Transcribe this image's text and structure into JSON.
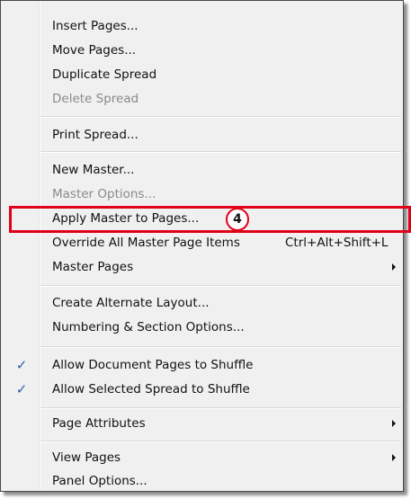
{
  "menu": {
    "items": [
      {
        "label": "Insert Pages...",
        "shortcut": "",
        "submenu": false,
        "disabled": false,
        "checked": false
      },
      {
        "label": "Move Pages...",
        "shortcut": "",
        "submenu": false,
        "disabled": false,
        "checked": false
      },
      {
        "label": "Duplicate Spread",
        "shortcut": "",
        "submenu": false,
        "disabled": false,
        "checked": false
      },
      {
        "label": "Delete Spread",
        "shortcut": "",
        "submenu": false,
        "disabled": true,
        "checked": false
      },
      {
        "label": "Print Spread...",
        "shortcut": "",
        "submenu": false,
        "disabled": false,
        "checked": false
      },
      {
        "label": "New Master...",
        "shortcut": "",
        "submenu": false,
        "disabled": false,
        "checked": false
      },
      {
        "label": "Master Options...",
        "shortcut": "",
        "submenu": false,
        "disabled": true,
        "checked": false
      },
      {
        "label": "Apply Master to Pages...",
        "shortcut": "",
        "submenu": false,
        "disabled": false,
        "checked": false
      },
      {
        "label": "Override All Master Page Items",
        "shortcut": "Ctrl+Alt+Shift+L",
        "submenu": false,
        "disabled": false,
        "checked": false
      },
      {
        "label": "Master Pages",
        "shortcut": "",
        "submenu": true,
        "disabled": false,
        "checked": false
      },
      {
        "label": "Create Alternate Layout...",
        "shortcut": "",
        "submenu": false,
        "disabled": false,
        "checked": false
      },
      {
        "label": "Numbering & Section Options...",
        "shortcut": "",
        "submenu": false,
        "disabled": false,
        "checked": false
      },
      {
        "label": "Allow Document Pages to Shuffle",
        "shortcut": "",
        "submenu": false,
        "disabled": false,
        "checked": true
      },
      {
        "label": "Allow Selected Spread to Shuffle",
        "shortcut": "",
        "submenu": false,
        "disabled": false,
        "checked": true
      },
      {
        "label": "Page Attributes",
        "shortcut": "",
        "submenu": true,
        "disabled": false,
        "checked": false
      },
      {
        "label": "View Pages",
        "shortcut": "",
        "submenu": true,
        "disabled": false,
        "checked": false
      },
      {
        "label": "Panel Options...",
        "shortcut": "",
        "submenu": false,
        "disabled": false,
        "checked": false
      }
    ]
  },
  "annotation": {
    "callout_number": "4",
    "highlight_color": "#e1001a"
  },
  "colors": {
    "check": "#2a5fb0",
    "disabled_text": "#8a8a8a"
  }
}
